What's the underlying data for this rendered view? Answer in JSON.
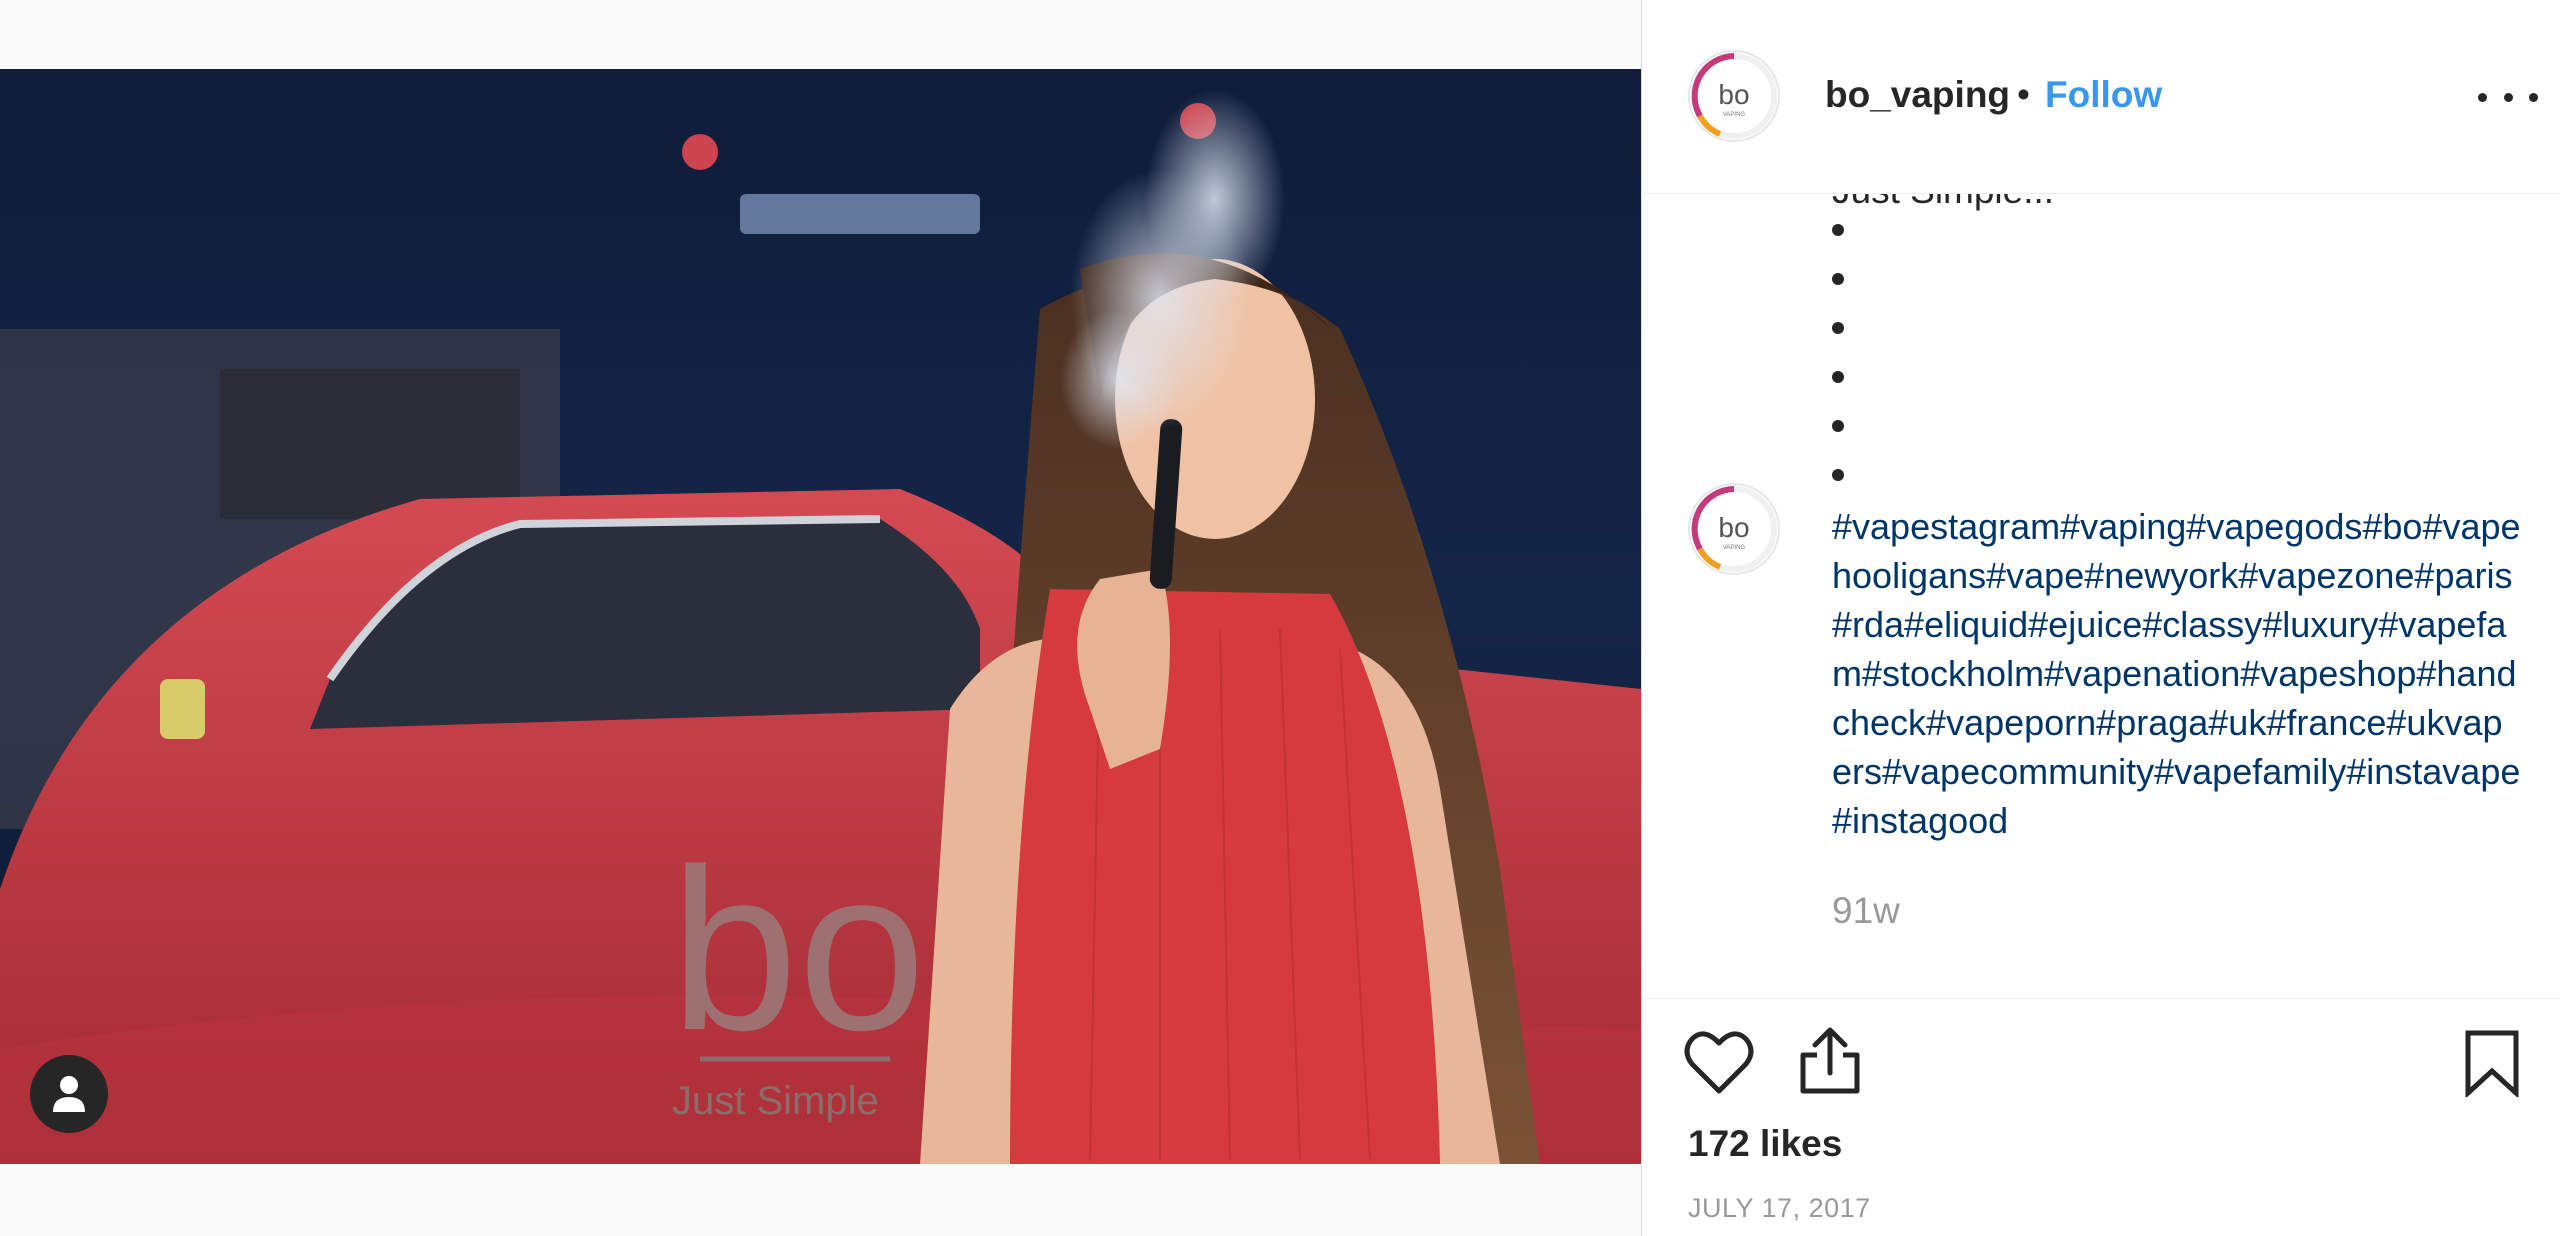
{
  "post": {
    "username": "bo_vaping",
    "separator": "•",
    "follow_label": "Follow",
    "more_label": "More options",
    "caption_top": "Just Simple...",
    "bullet_count": 6,
    "hashtags": "#vapestagram#vaping#vapegods#bo#vapehooligans#vape#newyork#vapezone#paris#rda#eliquid#ejuice#classy#luxury#vapefam#stockholm#vapenation#vapeshop#handcheck#vapeporn#praga#uk#france#ukvapers#vapecommunity#vapefamily#instavape#instagood",
    "time_ago": "91w",
    "likes": "172 likes",
    "date": "JULY 17, 2017"
  },
  "photo": {
    "logo_text": "bo",
    "logo_tagline": "Just Simple"
  },
  "avatar": {
    "logo_text": "bo",
    "logo_sub": "VAPING"
  },
  "colors": {
    "follow": "#3897f0",
    "hashtag": "#003569",
    "muted": "#999999",
    "text": "#262626"
  },
  "icons": {
    "like": "heart-icon",
    "share": "share-icon",
    "save": "bookmark-icon",
    "more": "ellipsis-icon",
    "user_tag": "person-icon"
  }
}
